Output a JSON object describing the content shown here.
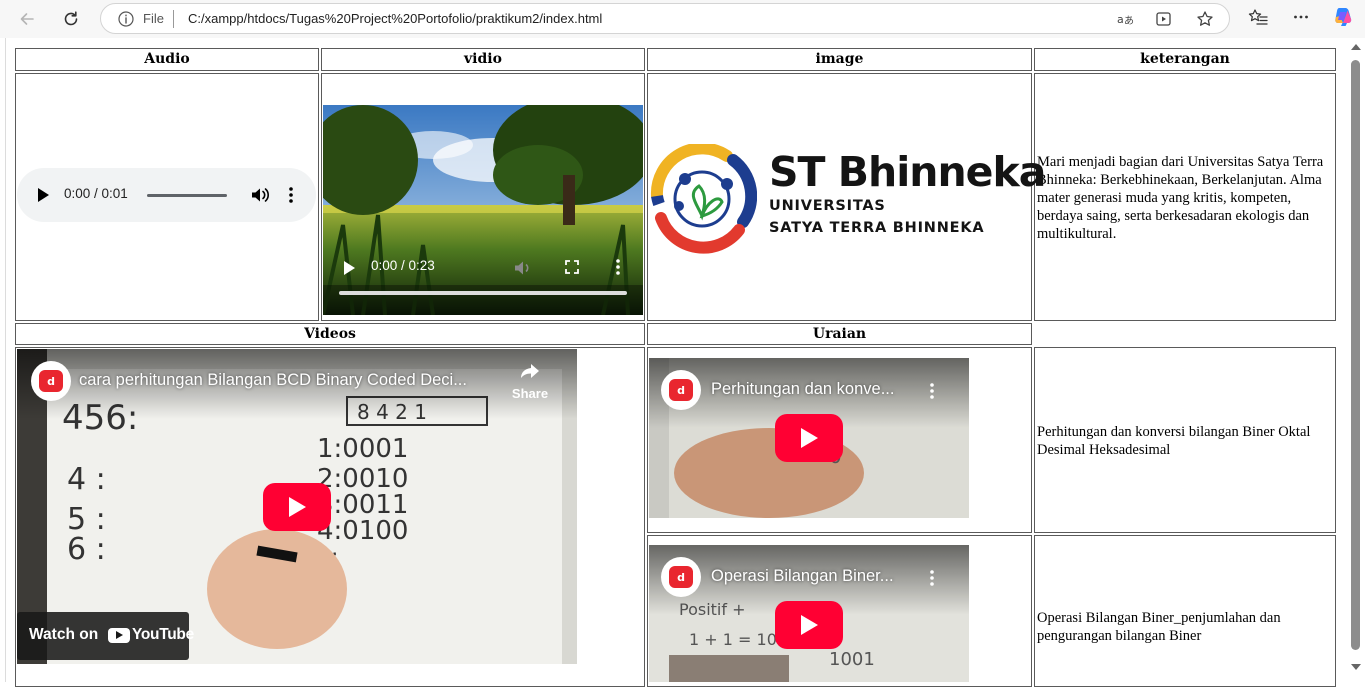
{
  "browser": {
    "file_label": "File",
    "url": "C:/xampp/htdocs/Tugas%20Project%20Portofolio/praktikum2/index.html"
  },
  "table": {
    "headers": [
      "Audio",
      "vidio",
      "image",
      "keterangan"
    ],
    "row2_headers": [
      "Videos",
      "Uraian"
    ],
    "audio": {
      "time": "0:00 / 0:01"
    },
    "video": {
      "time": "0:00 / 0:23"
    },
    "logo": {
      "brand": "ST Bhinneka",
      "line1": "UNIVERSITAS",
      "line2": "SATYA TERRA BHINNEKA"
    },
    "keterangan": "Mari menjadi bagian dari Universitas Satya Terra Bhinneka: Berkebhinekaan, Berkelanjutan. Alma mater generasi muda yang kritis, kompeten, berdaya saing, serta berkesadaran ekologis dan multikultural.",
    "yt_main": {
      "title": "cara perhitungan Bilangan BCD Binary Coded Deci...",
      "share": "Share",
      "watch_on": "Watch on",
      "youtube": "YouTube"
    },
    "yt_1": {
      "title": "Perhitungan dan konve..."
    },
    "yt_2": {
      "title": "Operasi Bilangan Biner..."
    },
    "uraian_1": "Perhitungan dan konversi bilangan Biner Oktal Desimal Heksadesimal",
    "uraian_2": "Operasi Bilangan Biner_penjumlahan dan pengurangan bilangan Biner"
  },
  "icons": {
    "back": "arrow-left-icon",
    "refresh": "refresh-icon",
    "info": "info-icon",
    "read_aloud": "read-aloud-icon",
    "immersive": "immersive-reader-icon",
    "favorite": "star-icon",
    "favorites_list": "favorites-list-icon",
    "more": "more-icon",
    "copilot": "copilot-icon"
  }
}
